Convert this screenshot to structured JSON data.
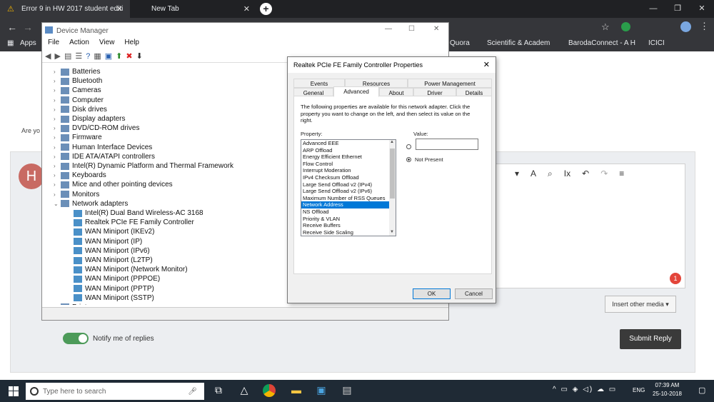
{
  "browser": {
    "tabs": [
      {
        "title": "Error 9 in HW 2017 student editi",
        "close": "✕"
      },
      {
        "title": "New Tab",
        "close": "✕"
      }
    ],
    "new_tab": "+",
    "bookmarks": [
      "Apps",
      "Quora",
      "Scientific & Academ",
      "BarodaConnect - A H",
      "ICICI"
    ]
  },
  "page": {
    "partial_text": "Are yo",
    "avatar_letter": "H",
    "insert_media": "Insert other media ▾",
    "notify_label": "Notify me of replies",
    "submit_label": "Submit Reply",
    "badge_count": "1"
  },
  "device_manager": {
    "title": "Device Manager",
    "menu": [
      "File",
      "Action",
      "View",
      "Help"
    ],
    "categories": [
      {
        "label": "Batteries",
        "icon": "battery-icon",
        "expanded": false
      },
      {
        "label": "Bluetooth",
        "icon": "bluetooth-icon",
        "expanded": false
      },
      {
        "label": "Cameras",
        "icon": "camera-icon",
        "expanded": false
      },
      {
        "label": "Computer",
        "icon": "computer-icon",
        "expanded": false
      },
      {
        "label": "Disk drives",
        "icon": "disk-icon",
        "expanded": false
      },
      {
        "label": "Display adapters",
        "icon": "display-icon",
        "expanded": false
      },
      {
        "label": "DVD/CD-ROM drives",
        "icon": "dvd-icon",
        "expanded": false
      },
      {
        "label": "Firmware",
        "icon": "chip-icon",
        "expanded": false
      },
      {
        "label": "Human Interface Devices",
        "icon": "hid-icon",
        "expanded": false
      },
      {
        "label": "IDE ATA/ATAPI controllers",
        "icon": "ide-icon",
        "expanded": false
      },
      {
        "label": "Intel(R) Dynamic Platform and Thermal Framework",
        "icon": "thermal-icon",
        "expanded": false
      },
      {
        "label": "Keyboards",
        "icon": "keyboard-icon",
        "expanded": false
      },
      {
        "label": "Mice and other pointing devices",
        "icon": "mouse-icon",
        "expanded": false
      },
      {
        "label": "Monitors",
        "icon": "monitor-icon",
        "expanded": false
      },
      {
        "label": "Network adapters",
        "icon": "network-icon",
        "expanded": true
      }
    ],
    "network_adapters": [
      "Intel(R) Dual Band Wireless-AC 3168",
      "Realtek PCIe FE Family Controller",
      "WAN Miniport (IKEv2)",
      "WAN Miniport (IP)",
      "WAN Miniport (IPv6)",
      "WAN Miniport (L2TP)",
      "WAN Miniport (Network Monitor)",
      "WAN Miniport (PPPOE)",
      "WAN Miniport (PPTP)",
      "WAN Miniport (SSTP)"
    ],
    "last_partial": "Print queues"
  },
  "properties": {
    "title": "Realtek PCIe FE Family Controller Properties",
    "tabs_row1": [
      "Events",
      "Resources",
      "Power Management"
    ],
    "tabs_row2": [
      "General",
      "Advanced",
      "About",
      "Driver",
      "Details"
    ],
    "active_tab": "Advanced",
    "description": "The following properties are available for this network adapter. Click the property you want to change on the left, and then select its value on the right.",
    "property_label": "Property:",
    "value_label": "Value:",
    "properties_list": [
      "Advanced EEE",
      "ARP Offload",
      "Energy Efficient Ethernet",
      "Flow Control",
      "Interrupt Moderation",
      "IPv4 Checksum Offload",
      "Large Send Offload v2 (IPv4)",
      "Large Send Offload v2 (IPv6)",
      "Maximum Number of RSS Queues",
      "Network Address",
      "NS Offload",
      "Priority & VLAN",
      "Receive Buffers",
      "Receive Side Scaling"
    ],
    "selected_property": "Network Address",
    "value_input": "",
    "not_present_label": "Not Present",
    "ok_label": "OK",
    "cancel_label": "Cancel"
  },
  "taskbar": {
    "search_placeholder": "Type here to search",
    "time": "07:39 AM",
    "date": "25-10-2018",
    "language": "ENG"
  }
}
